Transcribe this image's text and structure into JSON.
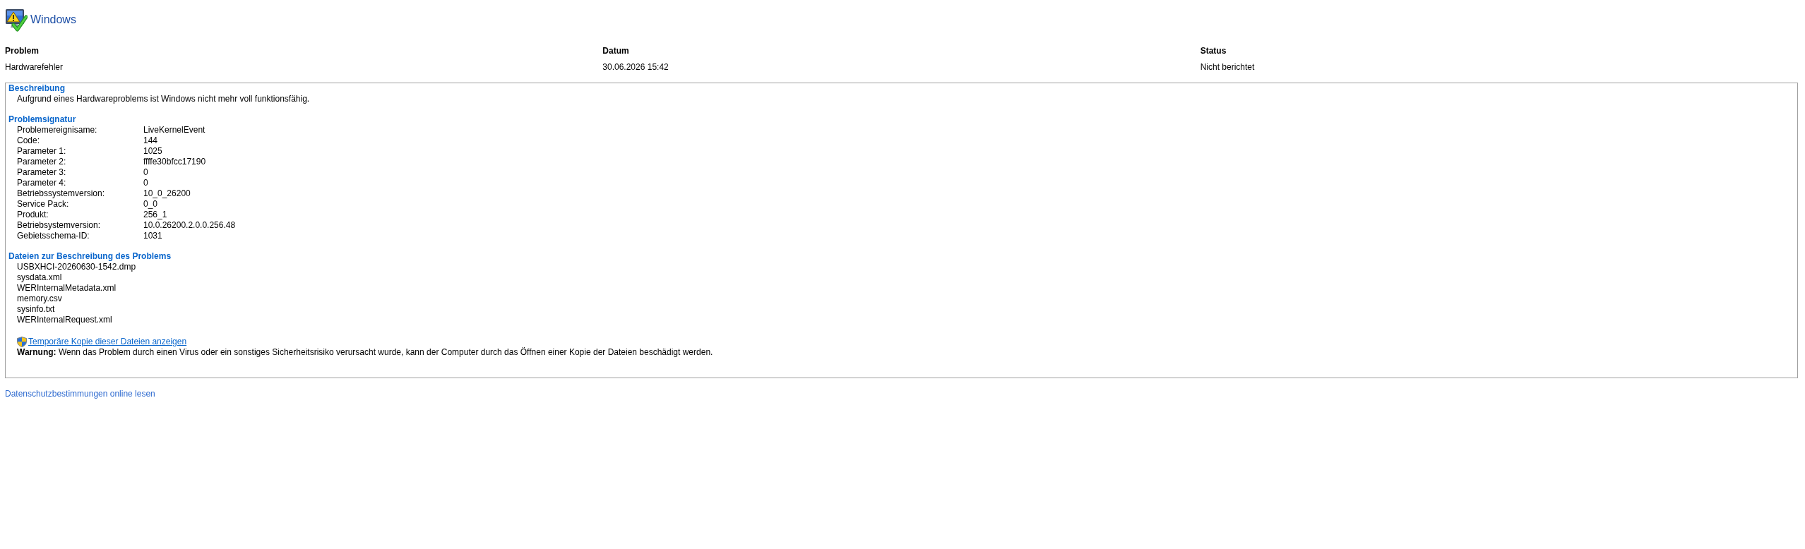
{
  "header": {
    "title": "Windows"
  },
  "summary": {
    "columns": [
      {
        "heading": "Problem",
        "value": "Hardwarefehler"
      },
      {
        "heading": "Datum",
        "value": "30.06.2026 15:42"
      },
      {
        "heading": "Status",
        "value": "Nicht berichtet"
      }
    ]
  },
  "details": {
    "sections": [
      {
        "kind": "text",
        "heading": "Beschreibung",
        "text": "Aufgrund eines Hardwareproblems ist Windows nicht mehr voll funktionsfähig."
      },
      {
        "kind": "fields",
        "heading": "Problemsignatur",
        "rows": [
          {
            "label": "Problemereignisame:",
            "value": "LiveKernelEvent"
          },
          {
            "label": "Code:",
            "value": "144"
          },
          {
            "label": "Parameter 1:",
            "value": "1025"
          },
          {
            "label": "Parameter 2:",
            "value": "ffffe30bfcc17190"
          },
          {
            "label": "Parameter 3:",
            "value": "0"
          },
          {
            "label": "Parameter 4:",
            "value": "0"
          },
          {
            "label": "Betriebssystemversion:",
            "value": "10_0_26200"
          },
          {
            "label": "Service Pack:",
            "value": "0_0"
          },
          {
            "label": "Produkt:",
            "value": "256_1"
          },
          {
            "label": "Betriebsystemversion:",
            "value": "10.0.26200.2.0.0.256.48"
          },
          {
            "label": "Gebietsschema-ID:",
            "value": "1031"
          }
        ]
      },
      {
        "kind": "files",
        "heading": "Dateien zur Beschreibung des Problems",
        "items": [
          "USBXHCI-20260630-1542.dmp",
          "sysdata.xml",
          "WERInternalMetadata.xml",
          "memory.csv",
          "sysinfo.txt",
          "WERInternalRequest.xml"
        ]
      }
    ],
    "temp_copy_link": "Temporäre Kopie dieser Dateien anzeigen",
    "warning": "**Warnung:** Wenn das Problem durch einen Virus oder ein sonstiges Sicherheitsrisiko verursacht wurde, kann der Computer durch das Öffnen einer Kopie der Dateien beschädigt werden."
  },
  "privacy_link": "Datenschutzbestimmungen online lesen"
}
